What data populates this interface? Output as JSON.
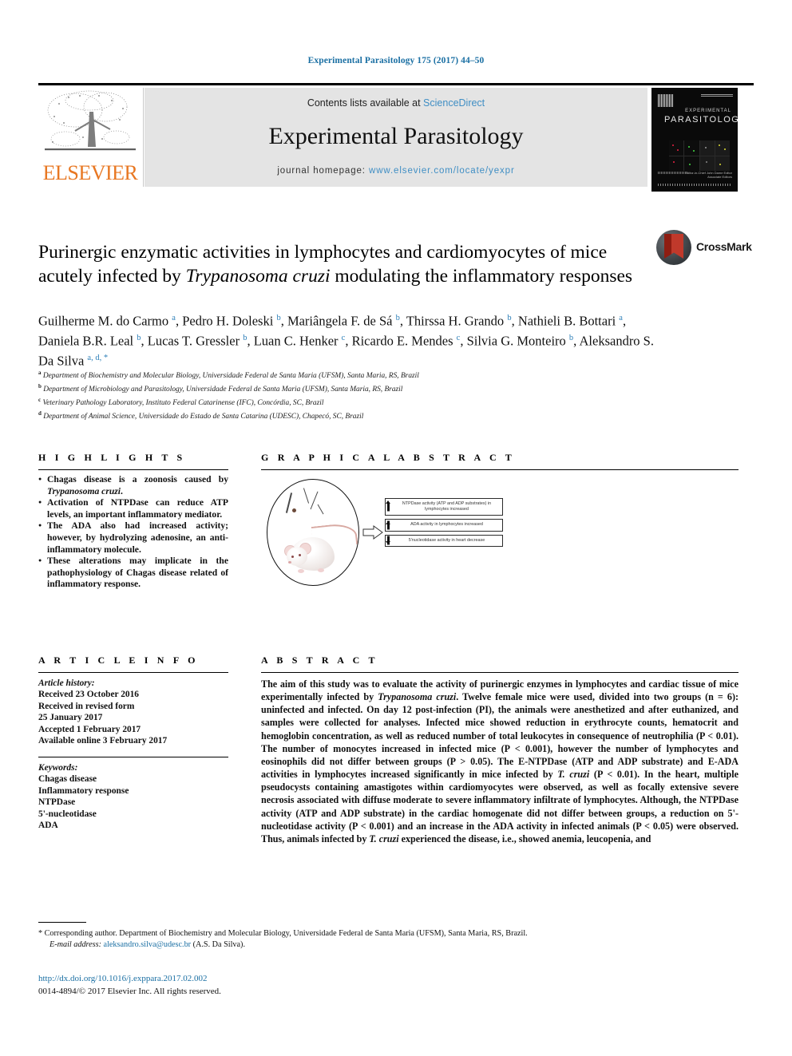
{
  "running_head": "Experimental Parasitology 175 (2017) 44–50",
  "masthead": {
    "contents_prefix": "Contents lists available at ",
    "sciencedirect": "ScienceDirect",
    "journal_name": "Experimental Parasitology",
    "homepage_label": "journal homepage: ",
    "homepage_url": "www.elsevier.com/locate/yexpr",
    "publisher": "ELSEVIER",
    "cover": {
      "title_small": "EXPERIMENTAL",
      "title_big": "PARASITOLOGY",
      "footer_lines": "Editor-in-Chief\nJohn Dame\nEditor\nAssociate Editors"
    }
  },
  "crossmark": {
    "label": "CrossMark"
  },
  "title": {
    "part1": "Purinergic enzymatic activities in lymphocytes and cardiomyocytes of mice acutely infected by ",
    "italic": "Trypanosoma cruzi",
    "part2": " modulating the inflammatory responses"
  },
  "authors_html": "Guilherme M. do Carmo <sup>a</sup>, Pedro H. Doleski <sup>b</sup>, Mariângela F. de Sá <sup>b</sup>, Thirssa H. Grando <sup>b</sup>, Nathieli B. Bottari <sup>a</sup>, Daniela B.R. Leal <sup>b</sup>, Lucas T. Gressler <sup>b</sup>, Luan C. Henker <sup>c</sup>, Ricardo E. Mendes <sup>c</sup>, Silvia G. Monteiro <sup>b</sup>, Aleksandro S. Da Silva <sup>a, d, *</sup>",
  "affiliations": [
    {
      "marker": "a",
      "text": "Department of Biochemistry and Molecular Biology, Universidade Federal de Santa Maria (UFSM), Santa Maria, RS, Brazil"
    },
    {
      "marker": "b",
      "text": "Department of Microbiology and Parasitology, Universidade Federal de Santa Maria (UFSM), Santa Maria, RS, Brazil"
    },
    {
      "marker": "c",
      "text": "Veterinary Pathology Laboratory, Instituto Federal Catarinense (IFC), Concórdia, SC, Brazil"
    },
    {
      "marker": "d",
      "text": "Department of Animal Science, Universidade do Estado de Santa Catarina (UDESC), Chapecó, SC, Brazil"
    }
  ],
  "highlights": {
    "heading": "H I G H L I G H T S",
    "items_html": [
      "Chagas disease is a zoonosis caused by <span class=\"it\">Trypanosoma cruzi</span>.",
      "Activation of NTPDase can reduce ATP levels, an important inflammatory mediator.",
      "The ADA also had increased activity; however, by hydrolyzing adenosine, an anti-inflammatory molecule.",
      "These alterations may implicate in the pathophysiology of Chagas disease related of inflammatory response."
    ]
  },
  "graphical_abstract": {
    "heading": "G R A P H I C A L   A B S T R A C T",
    "boxes": [
      {
        "text": "NTPDase activity (ATP and ADP substrates) in lymphocytes increased",
        "direction": "up"
      },
      {
        "text": "ADA activity in lymphocytes increased",
        "direction": "up"
      },
      {
        "text": "5'nucleotidase activity in heart decrease",
        "direction": "down"
      }
    ]
  },
  "article_info": {
    "heading": "A R T I C L E   I N F O",
    "history_label": "Article history:",
    "history_lines": [
      "Received 23 October 2016",
      "Received in revised form",
      "25 January 2017",
      "Accepted 1 February 2017",
      "Available online 3 February 2017"
    ],
    "keywords_label": "Keywords:",
    "keywords": [
      "Chagas disease",
      "Inflammatory response",
      "NTPDase",
      "5'-nucleotidase",
      "ADA"
    ]
  },
  "abstract": {
    "heading": "A B S T R A C T",
    "text_html": "The aim of this study was to evaluate the activity of purinergic enzymes in lymphocytes and cardiac tissue of mice experimentally infected by <span class=\"it\">Trypanosoma cruzi</span>. Twelve female mice were used, divided into two groups (n = 6): uninfected and infected. On day 12 post-infection (PI), the animals were anesthetized and after euthanized, and samples were collected for analyses. Infected mice showed reduction in erythrocyte counts, hematocrit and hemoglobin concentration, as well as reduced number of total leukocytes in consequence of neutrophilia (P &lt; 0.01). The number of monocytes increased in infected mice (P &lt; 0.001), however the number of lymphocytes and eosinophils did not differ between groups (P &gt; 0.05). The E-NTPDase (ATP and ADP substrate) and E-ADA activities in lymphocytes increased significantly in mice infected by <span class=\"it\">T. cruzi</span> (P &lt; 0.01). In the heart, multiple pseudocysts containing amastigotes within cardiomyocytes were observed, as well as focally extensive severe necrosis associated with diffuse moderate to severe inflammatory infiltrate of lymphocytes. Although, the NTPDase activity (ATP and ADP substrate) in the cardiac homogenate did not differ between groups, a reduction on 5'-nucleotidase activity (P &lt; 0.001) and an increase in the ADA activity in infected animals (P &lt; 0.05) were observed. Thus, animals infected by <span class=\"it\">T. cruzi</span> experienced the disease, i.e., showed anemia, leucopenia, and"
  },
  "footer": {
    "corresponding_marker": "*",
    "corresponding_text": "Corresponding author. Department of Biochemistry and Molecular Biology, Universidade Federal de Santa Maria (UFSM), Santa Maria, RS, Brazil.",
    "email_label": "E-mail address:",
    "email": "aleksandro.silva@udesc.br",
    "email_suffix": "(A.S. Da Silva).",
    "doi": "http://dx.doi.org/10.1016/j.exppara.2017.02.002",
    "copyright": "0014-4894/© 2017 Elsevier Inc. All rights reserved."
  }
}
